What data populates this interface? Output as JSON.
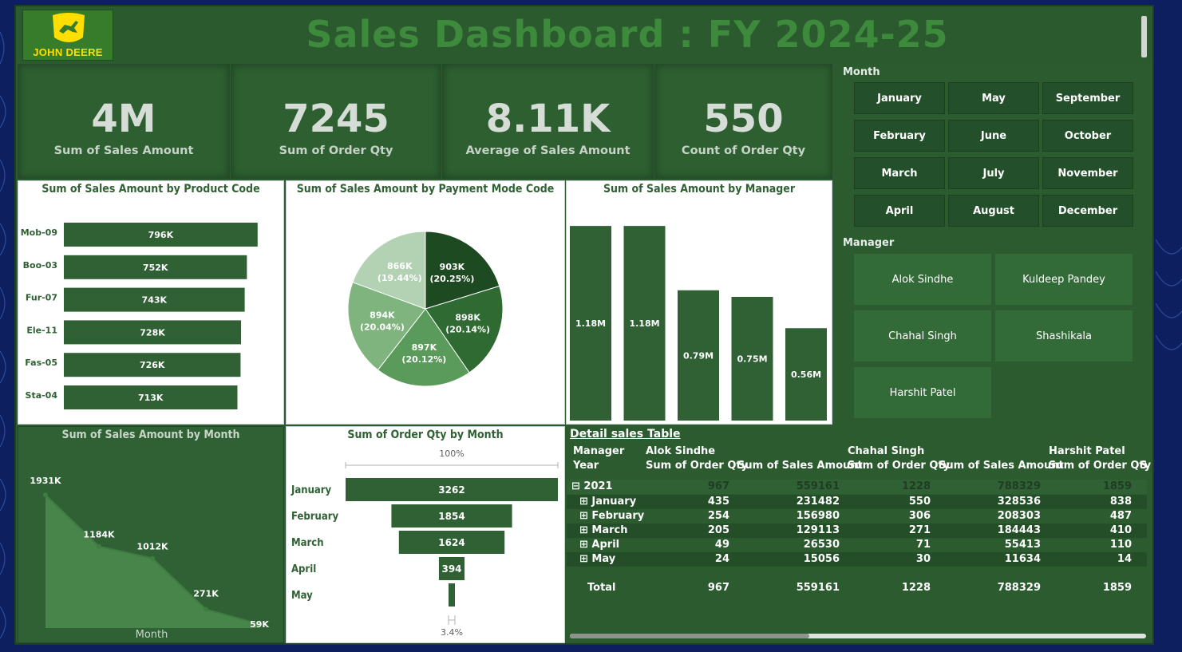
{
  "header": {
    "title": "Sales  Dashboard : FY  2024-25",
    "logo_text": "JOHN DEERE"
  },
  "colors": {
    "brand_green": "#367c2b",
    "brand_yellow": "#ffde00",
    "bar_green": "#2f6134",
    "panel_green": "#2d5f31"
  },
  "kpis": [
    {
      "value": "4M",
      "label": "Sum of Sales Amount"
    },
    {
      "value": "7245",
      "label": "Sum of Order Qty"
    },
    {
      "value": "8.11K",
      "label": "Average of Sales Amount"
    },
    {
      "value": "550",
      "label": "Count of Order Qty"
    }
  ],
  "slicers": {
    "month_label": "Month",
    "months": [
      "January",
      "May",
      "September",
      "February",
      "June",
      "October",
      "March",
      "July",
      "November",
      "April",
      "August",
      "December"
    ],
    "manager_label": "Manager",
    "managers": [
      "Alok Sindhe",
      "Kuldeep Pandey",
      "Chahal Singh",
      "Shashikala",
      "Harshit Patel"
    ]
  },
  "chart_data": [
    {
      "type": "bar",
      "orientation": "horizontal",
      "title": "Sum of Sales Amount by Product Code",
      "categories": [
        "Mob-09",
        "Boo-03",
        "Fur-07",
        "Ele-11",
        "Fas-05",
        "Sta-04"
      ],
      "values": [
        796000,
        752000,
        743000,
        728000,
        726000,
        713000
      ],
      "data_labels": [
        "796K",
        "752K",
        "743K",
        "728K",
        "726K",
        "713K"
      ]
    },
    {
      "type": "pie",
      "title": "Sum of Sales Amount by Payment Mode Code",
      "values": [
        903000,
        898000,
        897000,
        894000,
        866000
      ],
      "value_labels": [
        "903K",
        "898K",
        "897K",
        "894K",
        "866K"
      ],
      "percent_labels": [
        "(20.25%)",
        "(20.14%)",
        "(20.12%)",
        "(20.04%)",
        "(19.44%)"
      ],
      "colors": [
        "#1e4a22",
        "#2f6a33",
        "#5a9a5a",
        "#7fb47f",
        "#b3d1b3"
      ]
    },
    {
      "type": "bar",
      "orientation": "vertical",
      "title": "Sum of Sales Amount by Manager",
      "values": [
        1180000,
        1180000,
        790000,
        750000,
        560000
      ],
      "data_labels": [
        "1.18M",
        "1.18M",
        "0.79M",
        "0.75M",
        "0.56M"
      ]
    },
    {
      "type": "area",
      "title": "Sum of Sales Amount by Month",
      "xlabel": "Month",
      "values": [
        1931000,
        1184000,
        1012000,
        271000,
        59000
      ],
      "data_labels": [
        "1931K",
        "1184K",
        "1012K",
        "271K",
        "59K"
      ]
    },
    {
      "type": "funnel",
      "title": "Sum of Order Qty by Month",
      "categories": [
        "January",
        "February",
        "March",
        "April",
        "May"
      ],
      "values": [
        3262,
        1854,
        1624,
        394,
        59
      ],
      "data_labels": [
        "3262",
        "1854",
        "1624",
        "394",
        ""
      ],
      "top_pct": "100%",
      "bottom_pct": "3.4%"
    }
  ],
  "table": {
    "title": "Detail sales Table",
    "header_row1": [
      "Manager",
      "Alok Sindhe",
      "Chahal Singh",
      "Harshit Patel"
    ],
    "header_row2": [
      "Year",
      "Sum of Order Qty",
      "Sum of Sales Amount",
      "Sum of Order Qty",
      "Sum of Sales Amount",
      "Sum of Order Qty",
      "S"
    ],
    "year_row": {
      "label": "2021",
      "expander": "⊟",
      "values": [
        "967",
        "559161",
        "1228",
        "788329",
        "1859"
      ]
    },
    "rows": [
      {
        "label": "January",
        "expander": "⊞",
        "values": [
          "435",
          "231482",
          "550",
          "328536",
          "838"
        ]
      },
      {
        "label": "February",
        "expander": "⊞",
        "values": [
          "254",
          "156980",
          "306",
          "208303",
          "487"
        ]
      },
      {
        "label": "March",
        "expander": "⊞",
        "values": [
          "205",
          "129113",
          "271",
          "184443",
          "410"
        ]
      },
      {
        "label": "April",
        "expander": "⊞",
        "values": [
          "49",
          "26530",
          "71",
          "55413",
          "110"
        ]
      },
      {
        "label": "May",
        "expander": "⊞",
        "values": [
          "24",
          "15056",
          "30",
          "11634",
          "14"
        ]
      }
    ],
    "total_row": {
      "label": "Total",
      "values": [
        "967",
        "559161",
        "1228",
        "788329",
        "1859"
      ]
    }
  }
}
